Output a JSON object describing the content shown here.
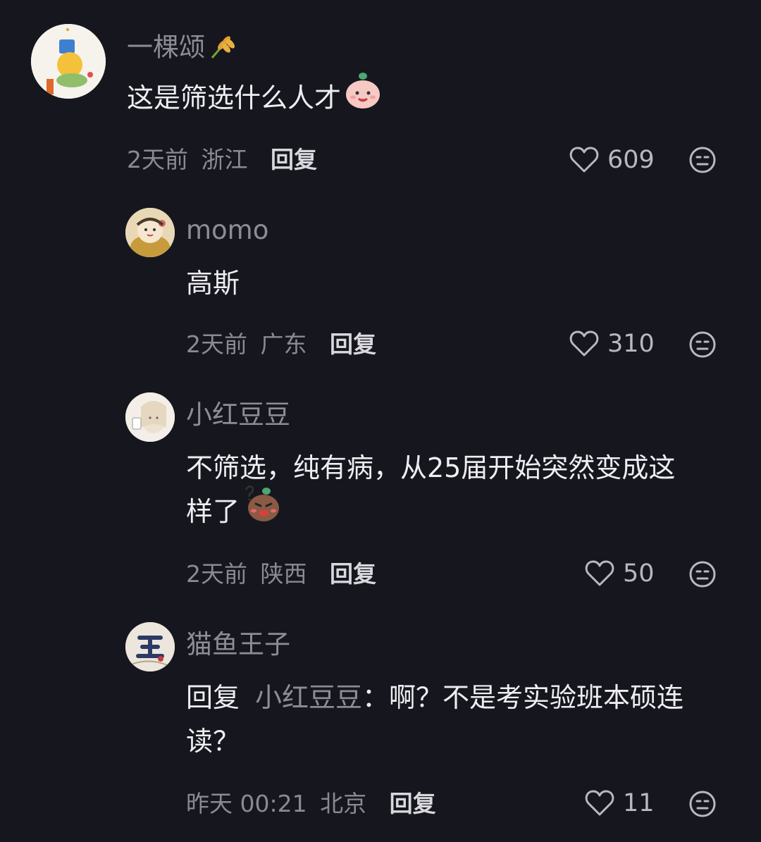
{
  "comments": [
    {
      "username": "一棵颂",
      "username_emoji": "wheat-emoji",
      "text": "这是筛选什么人才",
      "text_emoji": "smile-bean-emoji",
      "time": "2天前",
      "location": "浙江",
      "reply_label": "回复",
      "likes": "609"
    },
    {
      "username": "momo",
      "text": "高斯",
      "time": "2天前",
      "location": "广东",
      "reply_label": "回复",
      "likes": "310"
    },
    {
      "username": "小红豆豆",
      "text_line1": "不筛选，纯有病，从25届开始突然变成这",
      "text_line2": "样了",
      "text_emoji": "confused-bean-emoji",
      "time": "2天前",
      "location": "陕西",
      "reply_label": "回复",
      "likes": "50"
    },
    {
      "username": "猫鱼王子",
      "reply_prefix": "回复",
      "reply_target": "小红豆豆",
      "text_line1": "：啊？不是考实验班本硕连",
      "text_line2": "读？",
      "time": "昨天 00:21",
      "location": "北京",
      "reply_label": "回复",
      "likes": "11"
    }
  ],
  "colors": {
    "background": "#16161e",
    "username": "#8d8d96",
    "body": "#eeeef2",
    "meta": "#8a8a92"
  }
}
